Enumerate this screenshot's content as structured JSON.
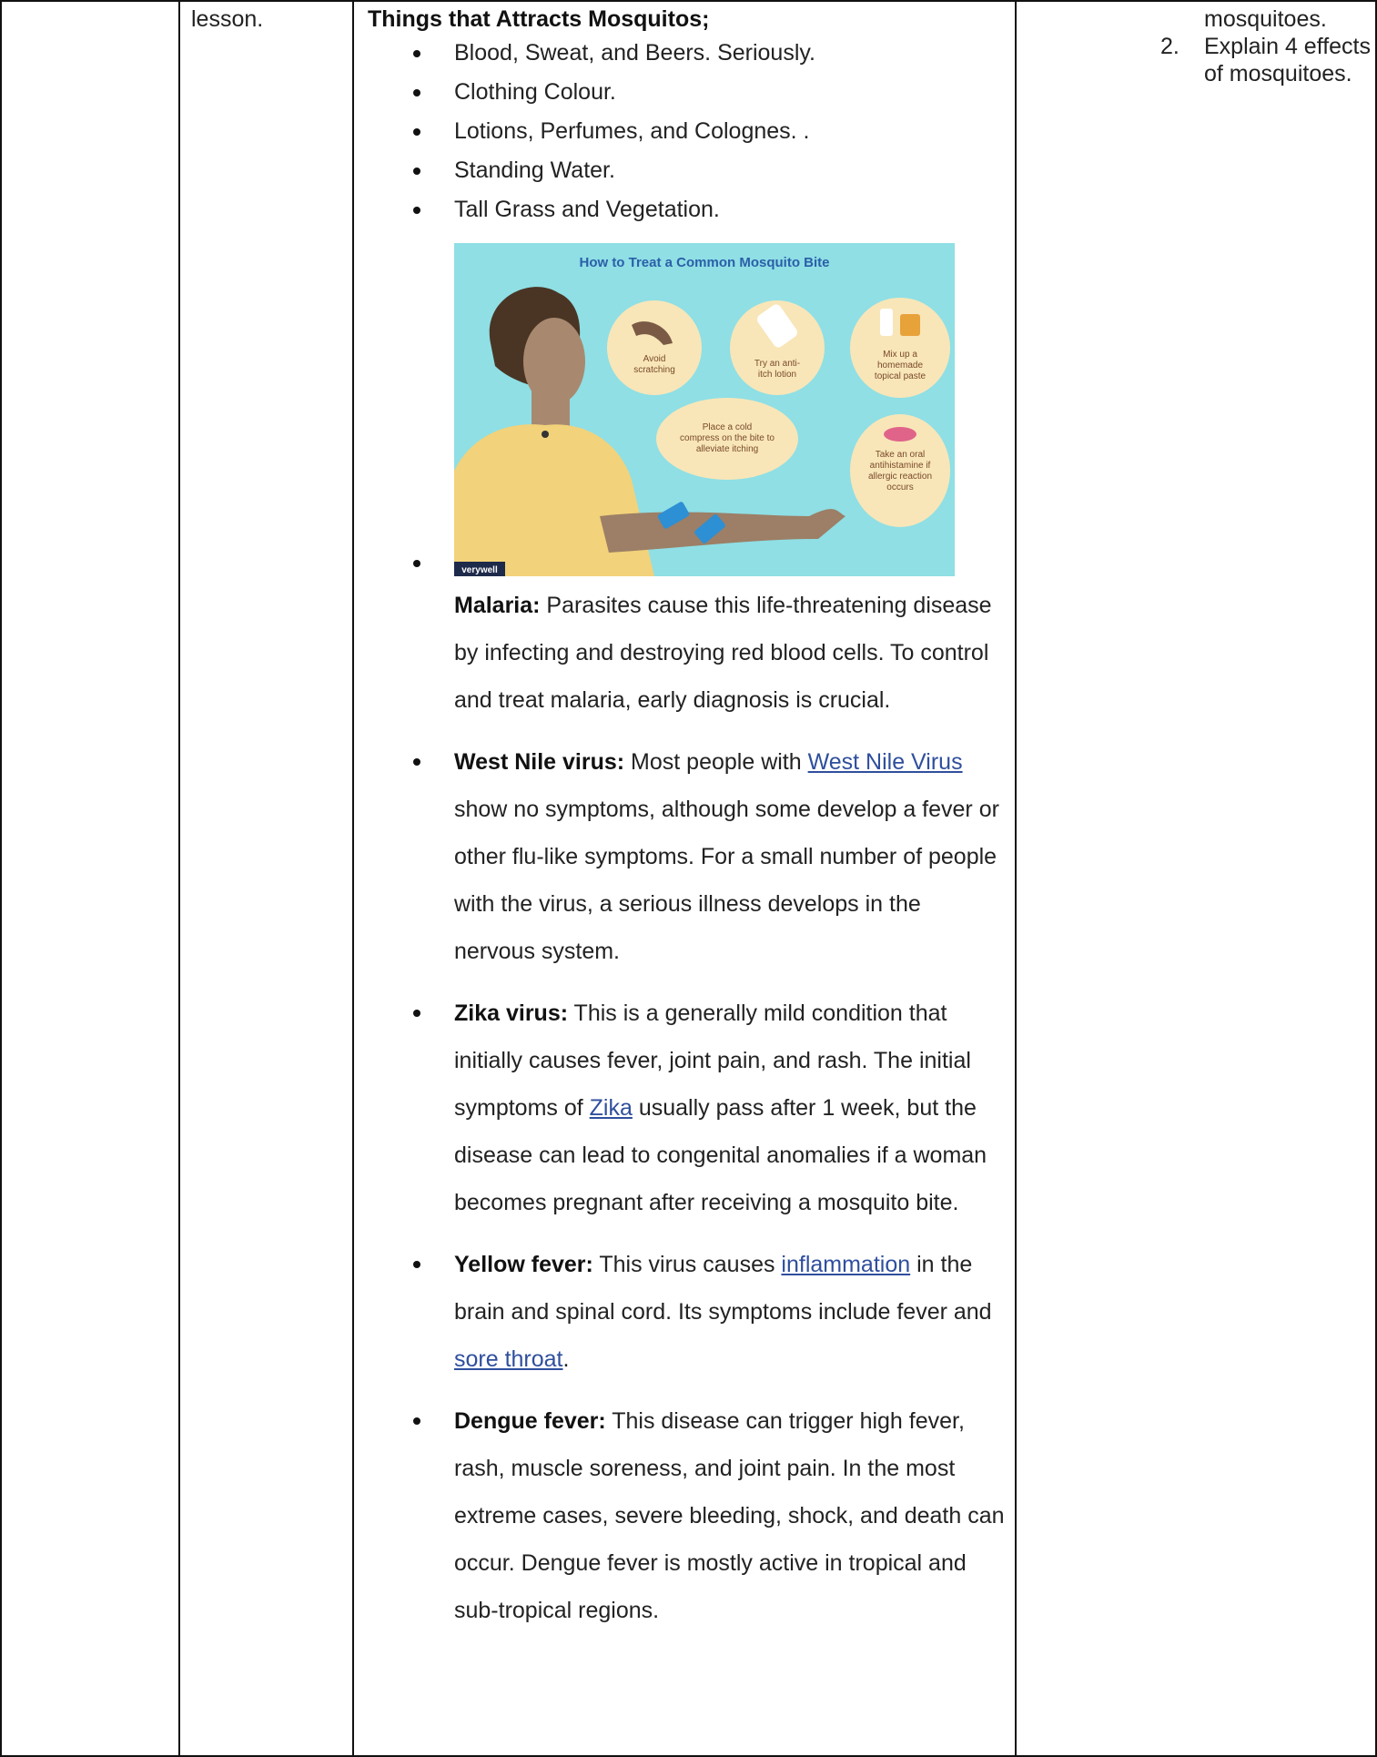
{
  "left_cell": {
    "text": "lesson."
  },
  "main": {
    "heading": "Things that Attracts Mosquitos;",
    "attract_items": [
      "Blood, Sweat, and Beers. Seriously.",
      "Clothing Colour.",
      "Lotions, Perfumes, and Colognes. .",
      "Standing Water.",
      "Tall Grass and Vegetation."
    ],
    "figure": {
      "title": "How to Treat a Common Mosquito Bite",
      "tips": [
        [
          "Avoid",
          "scratching"
        ],
        [
          "Try an anti-",
          "itch lotion"
        ],
        [
          "Mix up a",
          "homemade",
          "topical paste"
        ],
        [
          "Place a cold",
          "compress on the bite to",
          "alleviate itching"
        ],
        [
          "Take an oral",
          "antihistamine if",
          "allergic reaction",
          "occurs"
        ]
      ],
      "logo_text": "verywell",
      "colors": {
        "background": "#8fdfe5",
        "bubble": "#f8e6b8",
        "shirt": "#f2d27a",
        "skin": "#9c7f66"
      }
    },
    "diseases": [
      {
        "name": "Malaria:",
        "text": " Parasites cause this life-threatening disease by infecting and destroying red blood cells. To control and treat malaria, early diagnosis is crucial."
      },
      {
        "name": "West Nile virus:",
        "pre": " Most people with ",
        "link": "West Nile Virus",
        "post": " show no symptoms, although some develop a fever or other flu-like symptoms. For a small number of people with the virus, a serious illness develops in the nervous system."
      },
      {
        "name": "Zika virus:",
        "pre": " This is a generally mild condition that initially causes fever, joint pain, and rash. The initial symptoms of ",
        "link": "Zika",
        "post": " usually pass after 1 week, but the disease can lead to congenital anomalies if a woman becomes pregnant after receiving a mosquito bite."
      },
      {
        "name": "Yellow fever:",
        "pre": " This virus causes ",
        "link": "inflammation",
        "mid": " in the brain and spinal cord. Its symptoms include fever and ",
        "link2": "sore throat",
        "post": "."
      },
      {
        "name": "Dengue fever:",
        "text": " This disease can trigger high fever, rash, muscle soreness, and joint pain. In the most extreme cases, severe bleeding, shock, and death can occur. Dengue fever is mostly active in tropical and sub-tropical regions."
      }
    ]
  },
  "right_cell": {
    "continuation": "mosquitoes.",
    "items": [
      {
        "num": "2.",
        "text": "Explain 4 effects of mosquitoes."
      }
    ]
  }
}
